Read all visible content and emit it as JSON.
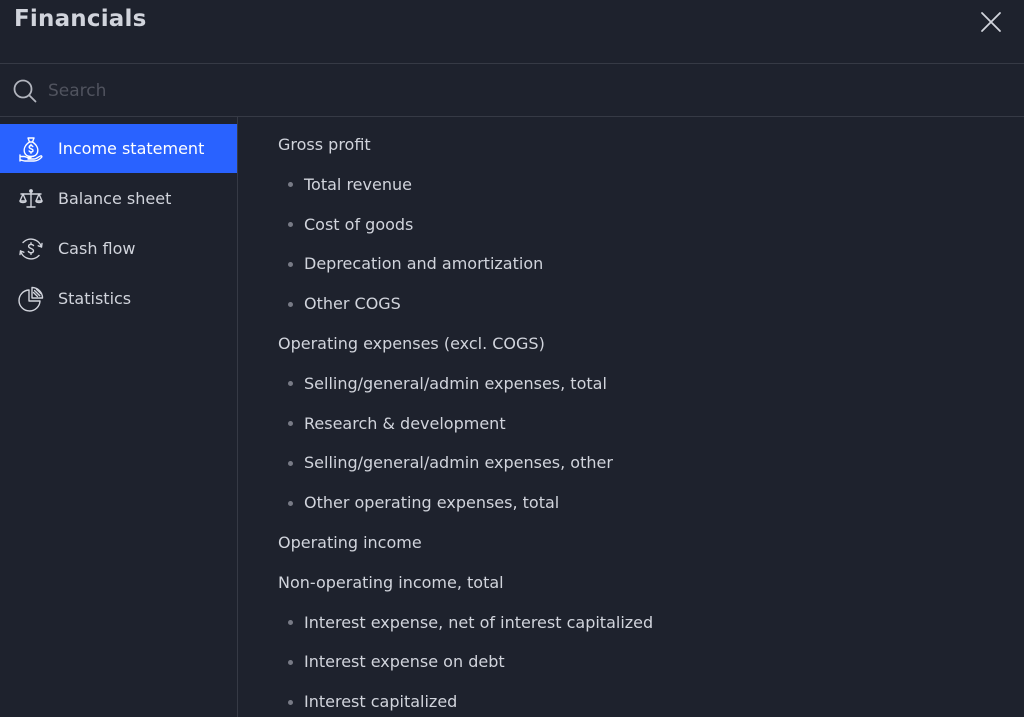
{
  "header": {
    "title": "Financials"
  },
  "search": {
    "placeholder": "Search"
  },
  "sidebar": {
    "items": [
      {
        "label": "Income statement",
        "icon": "money-bag-icon",
        "active": true
      },
      {
        "label": "Balance sheet",
        "icon": "scales-icon",
        "active": false
      },
      {
        "label": "Cash flow",
        "icon": "cash-flow-icon",
        "active": false
      },
      {
        "label": "Statistics",
        "icon": "pie-chart-icon",
        "active": false
      }
    ]
  },
  "content": {
    "items": [
      {
        "label": "Gross profit",
        "level": "group"
      },
      {
        "label": "Total revenue",
        "level": "sub"
      },
      {
        "label": "Cost of goods",
        "level": "sub"
      },
      {
        "label": "Deprecation and amortization",
        "level": "sub"
      },
      {
        "label": "Other COGS",
        "level": "sub"
      },
      {
        "label": "Operating expenses (excl. COGS)",
        "level": "group"
      },
      {
        "label": "Selling/general/admin expenses, total",
        "level": "sub"
      },
      {
        "label": "Research & development",
        "level": "sub"
      },
      {
        "label": "Selling/general/admin expenses, other",
        "level": "sub"
      },
      {
        "label": "Other operating expenses, total",
        "level": "sub"
      },
      {
        "label": "Operating income",
        "level": "group"
      },
      {
        "label": "Non-operating income, total",
        "level": "group"
      },
      {
        "label": "Interest expense, net of interest capitalized",
        "level": "sub"
      },
      {
        "label": "Interest expense on debt",
        "level": "sub"
      },
      {
        "label": "Interest capitalized",
        "level": "sub"
      }
    ]
  },
  "colors": {
    "background": "#1e222d",
    "accent": "#2962ff",
    "text": "#d1d4dc",
    "divider": "#363a45"
  }
}
